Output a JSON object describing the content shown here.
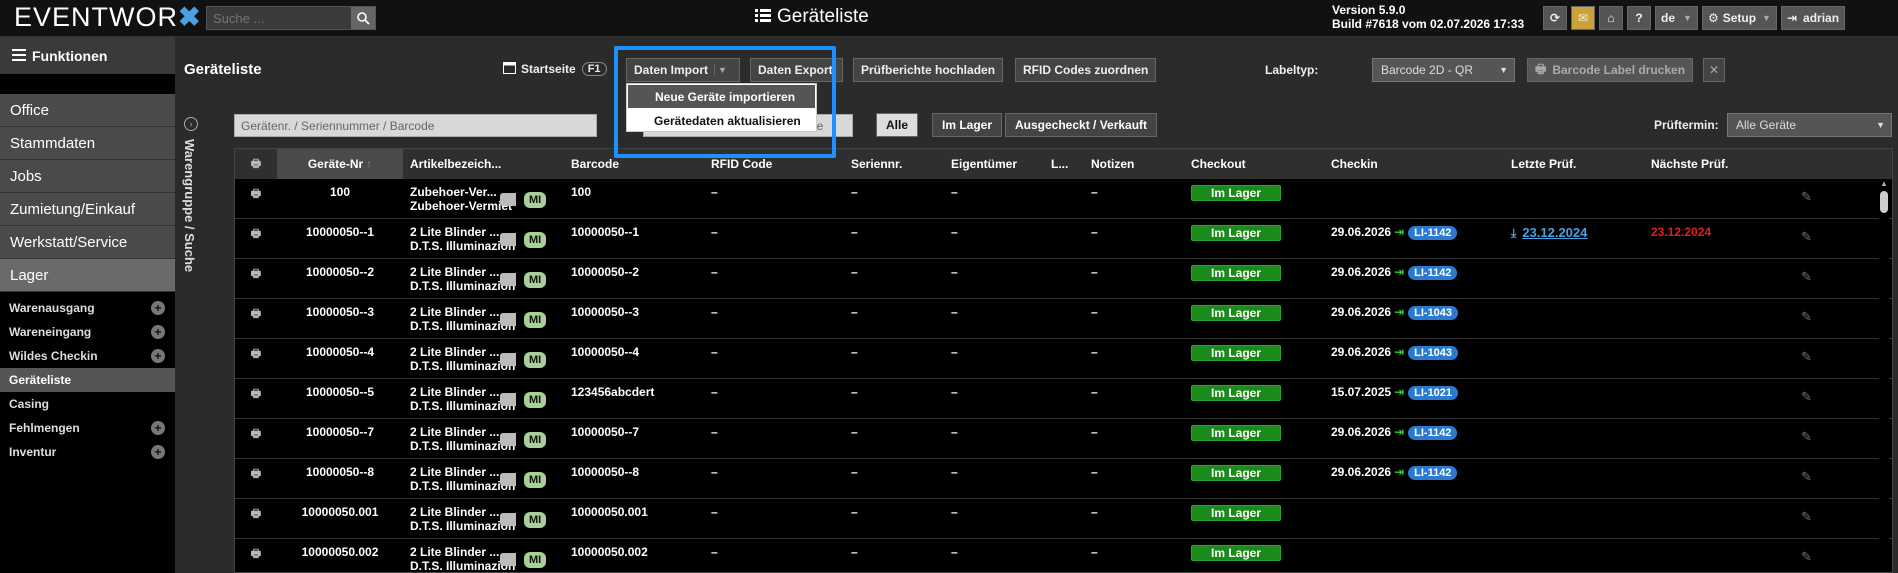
{
  "topbar": {
    "logo_text": "EVENTWOR",
    "logo_x": "✖",
    "search_placeholder": "Suche ...",
    "page_title": "Geräteliste",
    "version_line1": "Version 5.9.0",
    "version_line2": "Build #7618 vom 02.07.2026 17:33",
    "help_label": "?",
    "lang_label": "de",
    "setup_label": "Setup",
    "user_label": "adrian"
  },
  "sidebar": {
    "funktionen": "Funktionen",
    "main_items": [
      "Office",
      "Stammdaten",
      "Jobs",
      "Zumietung/Einkauf",
      "Werkstatt/Service",
      "Lager"
    ],
    "sub_items": [
      {
        "label": "Warenausgang",
        "plus": true
      },
      {
        "label": "Wareneingang",
        "plus": true
      },
      {
        "label": "Wildes Checkin",
        "plus": true
      },
      {
        "label": "Geräteliste",
        "plus": false
      },
      {
        "label": "Casing",
        "plus": false
      },
      {
        "label": "Fehlmengen",
        "plus": true
      },
      {
        "label": "Inventur",
        "plus": true
      }
    ],
    "side_tab": "Warengruppe / Suche"
  },
  "toolbar": {
    "title": "Geräteliste",
    "startseite": "Startseite",
    "f1": "F1",
    "daten_import": "Daten Import",
    "daten_export": "Daten Export",
    "pruefberichte": "Prüfberichte hochladen",
    "rfid": "RFID Codes zuordnen",
    "labeltyp_label": "Labeltyp:",
    "labeltyp_value": "Barcode 2D - QR",
    "barcode_print": "Barcode Label drucken"
  },
  "dropdown": {
    "item1": "Neue Geräte importieren",
    "item2": "Gerätedaten aktualisieren"
  },
  "filters": {
    "search_placeholder": "Gerätenr. / Seriennummer / Barcode",
    "search2_tail": "le",
    "seg_all": "Alle",
    "seg_lager": "Im Lager",
    "seg_out": "Ausgecheckt / Verkauft",
    "prueftermin_label": "Prüftermin:",
    "prueftermin_value": "Alle Geräte"
  },
  "table": {
    "headers": [
      "Geräte-Nr",
      "Artikelbezeich...",
      "Barcode",
      "RFID Code",
      "Seriennr.",
      "Eigentümer",
      "L...",
      "Notizen",
      "Checkout",
      "Checkin",
      "Letzte Prüf.",
      "Nächste Prüf."
    ],
    "rows": [
      {
        "nr": "100",
        "art1": "Zubehoer-Ver...",
        "art2": "Zubehoer-Vermiet",
        "barcode": "100",
        "rfid": "–",
        "serien": "–",
        "eigen": "–",
        "notiz": "–",
        "checkout": "Im Lager",
        "checkin_date": "",
        "li": "",
        "letzte": "",
        "naechste": ""
      },
      {
        "nr": "10000050--1",
        "art1": "2 Lite Blinder ...",
        "art2": "D.T.S. Illuminazion",
        "barcode": "10000050--1",
        "rfid": "–",
        "serien": "–",
        "eigen": "–",
        "notiz": "–",
        "checkout": "Im Lager",
        "checkin_date": "29.06.2026",
        "li": "LI-1142",
        "letzte": "23.12.2024",
        "naechste": "23.12.2024"
      },
      {
        "nr": "10000050--2",
        "art1": "2 Lite Blinder ...",
        "art2": "D.T.S. Illuminazion",
        "barcode": "10000050--2",
        "rfid": "–",
        "serien": "–",
        "eigen": "–",
        "notiz": "–",
        "checkout": "Im Lager",
        "checkin_date": "29.06.2026",
        "li": "LI-1142",
        "letzte": "",
        "naechste": ""
      },
      {
        "nr": "10000050--3",
        "art1": "2 Lite Blinder ...",
        "art2": "D.T.S. Illuminazion",
        "barcode": "10000050--3",
        "rfid": "–",
        "serien": "–",
        "eigen": "–",
        "notiz": "–",
        "checkout": "Im Lager",
        "checkin_date": "29.06.2026",
        "li": "LI-1043",
        "letzte": "",
        "naechste": ""
      },
      {
        "nr": "10000050--4",
        "art1": "2 Lite Blinder ...",
        "art2": "D.T.S. Illuminazion",
        "barcode": "10000050--4",
        "rfid": "–",
        "serien": "–",
        "eigen": "–",
        "notiz": "–",
        "checkout": "Im Lager",
        "checkin_date": "29.06.2026",
        "li": "LI-1043",
        "letzte": "",
        "naechste": ""
      },
      {
        "nr": "10000050--5",
        "art1": "2 Lite Blinder ...",
        "art2": "D.T.S. Illuminazion",
        "barcode": "123456abcdert",
        "rfid": "–",
        "serien": "–",
        "eigen": "–",
        "notiz": "–",
        "checkout": "Im Lager",
        "checkin_date": "15.07.2025",
        "li": "LI-1021",
        "letzte": "",
        "naechste": ""
      },
      {
        "nr": "10000050--7",
        "art1": "2 Lite Blinder ...",
        "art2": "D.T.S. Illuminazion",
        "barcode": "10000050--7",
        "rfid": "–",
        "serien": "–",
        "eigen": "–",
        "notiz": "–",
        "checkout": "Im Lager",
        "checkin_date": "29.06.2026",
        "li": "LI-1142",
        "letzte": "",
        "naechste": ""
      },
      {
        "nr": "10000050--8",
        "art1": "2 Lite Blinder ...",
        "art2": "D.T.S. Illuminazion",
        "barcode": "10000050--8",
        "rfid": "–",
        "serien": "–",
        "eigen": "–",
        "notiz": "–",
        "checkout": "Im Lager",
        "checkin_date": "29.06.2026",
        "li": "LI-1142",
        "letzte": "",
        "naechste": ""
      },
      {
        "nr": "10000050.001",
        "art1": "2 Lite Blinder ...",
        "art2": "D.T.S. Illuminazion",
        "barcode": "10000050.001",
        "rfid": "–",
        "serien": "–",
        "eigen": "–",
        "notiz": "–",
        "checkout": "Im Lager",
        "checkin_date": "",
        "li": "",
        "letzte": "",
        "naechste": ""
      },
      {
        "nr": "10000050.002",
        "art1": "2 Lite Blinder ...",
        "art2": "D.T.S. Illuminazion",
        "barcode": "10000050.002",
        "rfid": "–",
        "serien": "–",
        "eigen": "–",
        "notiz": "–",
        "checkout": "Im Lager",
        "checkin_date": "",
        "li": "",
        "letzte": "",
        "naechste": ""
      }
    ],
    "mi_label": "MI"
  },
  "colors": {
    "accent": "#4aa0e0",
    "highlight": "#1e90ff",
    "green": "#1a8a1a",
    "badge": "#2a7ad0",
    "red": "#e02020"
  }
}
